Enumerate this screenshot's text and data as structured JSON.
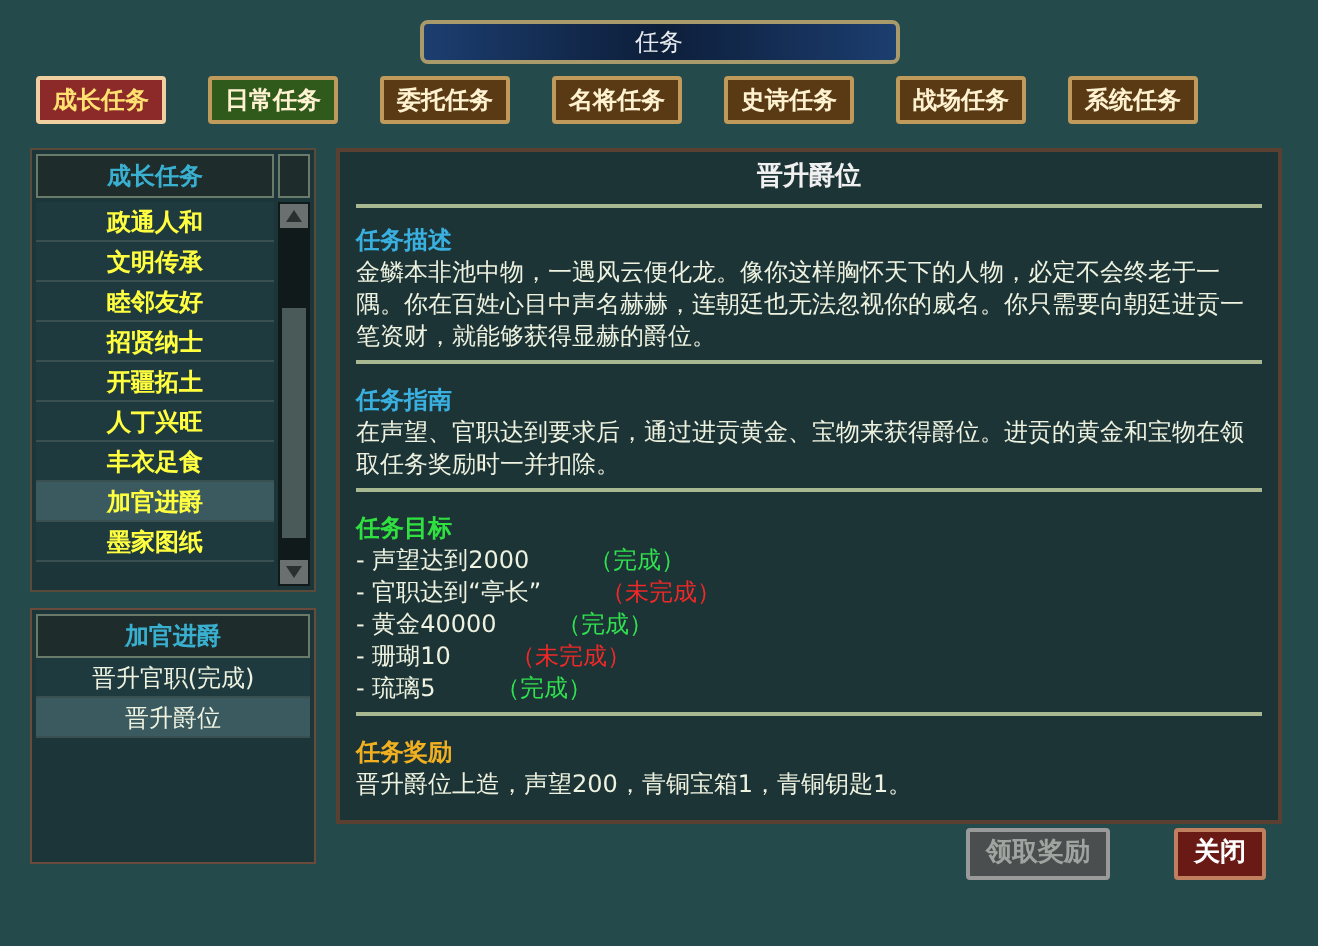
{
  "window": {
    "title": "任务"
  },
  "tabs": [
    {
      "label": "成长任务",
      "selected": true,
      "color": "#8c2a2a"
    },
    {
      "label": "日常任务",
      "selected": false,
      "color": "#2f5a1c"
    },
    {
      "label": "委托任务",
      "selected": false,
      "color": "#5a3a14"
    },
    {
      "label": "名将任务",
      "selected": false,
      "color": "#5a3a14"
    },
    {
      "label": "史诗任务",
      "selected": false,
      "color": "#5a3a14"
    },
    {
      "label": "战场任务",
      "selected": false,
      "color": "#5a3a14"
    },
    {
      "label": "系统任务",
      "selected": false,
      "color": "#5a3a14"
    }
  ],
  "category_list": {
    "title": "成长任务",
    "items": [
      {
        "label": "政通人和",
        "selected": false
      },
      {
        "label": "文明传承",
        "selected": false
      },
      {
        "label": "睦邻友好",
        "selected": false
      },
      {
        "label": "招贤纳士",
        "selected": false
      },
      {
        "label": "开疆拓土",
        "selected": false
      },
      {
        "label": "人丁兴旺",
        "selected": false
      },
      {
        "label": "丰衣足食",
        "selected": false
      },
      {
        "label": "加官进爵",
        "selected": true
      },
      {
        "label": "墨家图纸",
        "selected": false
      }
    ]
  },
  "quest_list": {
    "title": "加官进爵",
    "items": [
      {
        "label": "晋升官职(完成)",
        "selected": false
      },
      {
        "label": "晋升爵位",
        "selected": true
      }
    ]
  },
  "detail": {
    "title": "晋升爵位",
    "description": {
      "heading": "任务描述",
      "text": "金鳞本非池中物，一遇风云便化龙。像你这样胸怀天下的人物，必定不会终老于一隅。你在百姓心目中声名赫赫，连朝廷也无法忽视你的威名。你只需要向朝廷进贡一笔资财，就能够获得显赫的爵位。"
    },
    "guide": {
      "heading": "任务指南",
      "text": "在声望、官职达到要求后，通过进贡黄金、宝物来获得爵位。进贡的黄金和宝物在领取任务奖励时一并扣除。"
    },
    "goals": {
      "heading": "任务目标",
      "items": [
        {
          "text": "- 声望达到2000",
          "status": "（完成）",
          "done": true
        },
        {
          "text": "- 官职达到“亭长”",
          "status": "（未完成）",
          "done": false
        },
        {
          "text": "- 黄金40000",
          "status": "（完成）",
          "done": true
        },
        {
          "text": "- 珊瑚10",
          "status": "（未完成）",
          "done": false
        },
        {
          "text": "- 琉璃5",
          "status": "（完成）",
          "done": true
        }
      ]
    },
    "reward": {
      "heading": "任务奖励",
      "text": "晋升爵位上造，声望200，青铜宝箱1，青铜钥匙1。"
    }
  },
  "buttons": [
    {
      "label": "领取奖励",
      "kind": "disabled"
    },
    {
      "label": "关闭",
      "kind": "danger"
    }
  ]
}
